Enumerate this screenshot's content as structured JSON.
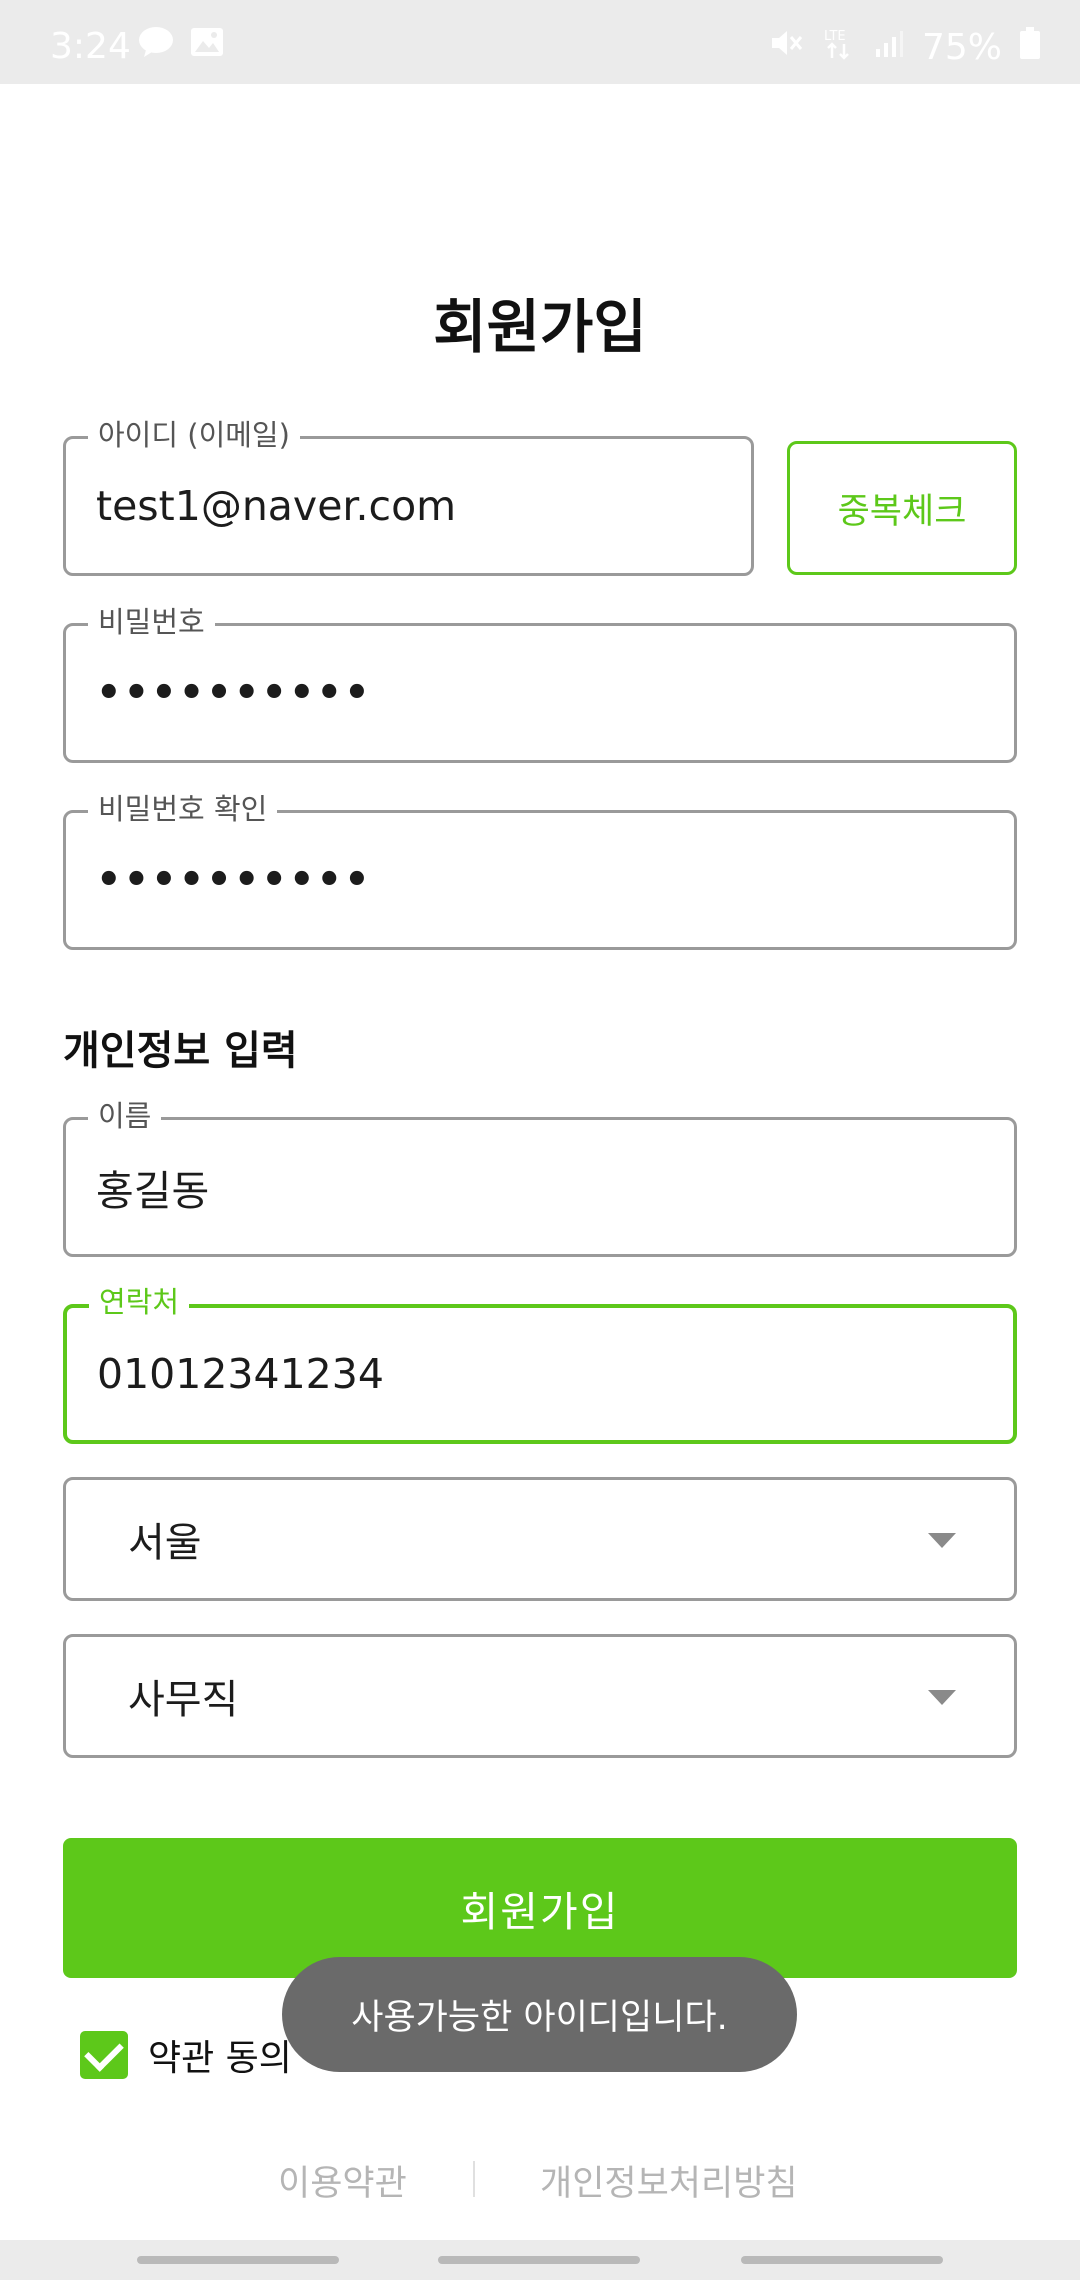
{
  "status_bar": {
    "time": "3:24",
    "left_icons": [
      "talk-icon",
      "image-icon"
    ],
    "right_icons": [
      "mute-icon",
      "lte-icon",
      "signal-icon"
    ],
    "battery": "75%"
  },
  "page_title": "회원가입",
  "fields": {
    "email": {
      "label": "아이디 (이메일)",
      "value": "test1@naver.com"
    },
    "password": {
      "label": "비밀번호",
      "value": "••••••••••"
    },
    "password_confirm": {
      "label": "비밀번호 확인",
      "value": "••••••••••"
    },
    "name": {
      "label": "이름",
      "value": "홍길동"
    },
    "phone": {
      "label": "연락처",
      "value": "01012341234"
    }
  },
  "dup_check_label": "중복체크",
  "section_title": "개인정보 입력",
  "selects": {
    "region": {
      "value": "서울"
    },
    "job": {
      "value": "사무직"
    }
  },
  "signup_button": "회원가입",
  "agree": {
    "label": "약관 동의",
    "checked": true
  },
  "toast": "사용가능한 아이디입니다.",
  "footer": {
    "terms": "이용약관",
    "privacy": "개인정보처리방침"
  },
  "colors": {
    "accent": "#5dc81a",
    "border": "#9a9a9a",
    "toast_bg": "#6a6a6a"
  }
}
